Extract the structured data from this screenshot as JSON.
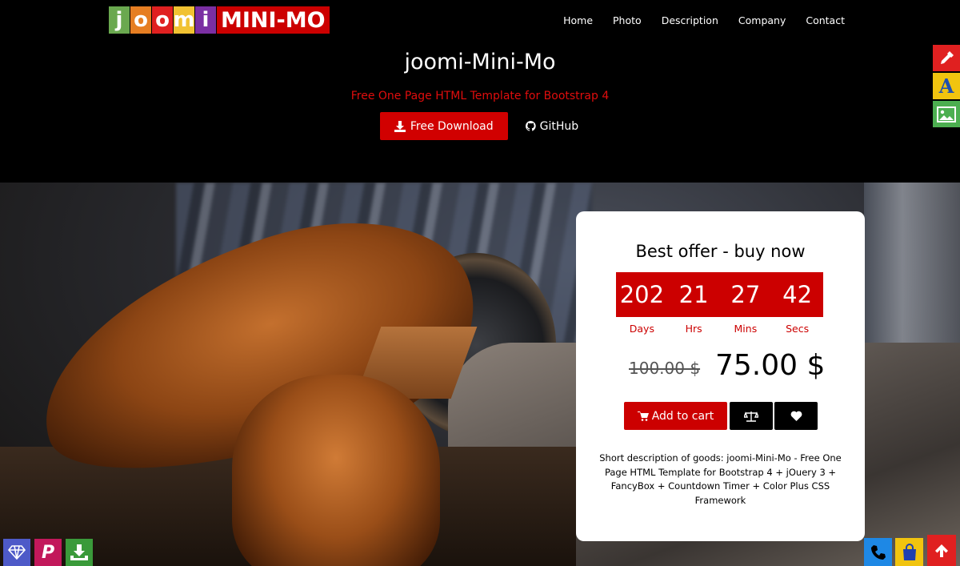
{
  "logo": {
    "letters": [
      {
        "char": "j",
        "color": "#6aa84f"
      },
      {
        "char": "o",
        "color": "#e67e22"
      },
      {
        "char": "o",
        "color": "#e02020"
      },
      {
        "char": "m",
        "color": "#f1c232"
      },
      {
        "char": "i",
        "color": "#7b2fa3"
      }
    ],
    "mini": "MINI-MO"
  },
  "nav": [
    "Home",
    "Photo",
    "Description",
    "Company",
    "Contact"
  ],
  "hero": {
    "title": "joomi-Mini-Mo",
    "subtitle": "Free One Page HTML Template for Bootstrap 4",
    "download_label": "Free Download",
    "github_label": "GitHub"
  },
  "offer": {
    "title": "Best offer - buy now",
    "timer": {
      "days": "202",
      "hrs": "21",
      "mins": "27",
      "secs": "42"
    },
    "timer_labels": {
      "days": "Days",
      "hrs": "Hrs",
      "mins": "Mins",
      "secs": "Secs"
    },
    "old_price": "100.00 $",
    "new_price": "75.00 $",
    "cart_label": "Add to cart",
    "description": "Short description of goods: joomi-Mini-Mo - Free One Page HTML Template for Bootstrap 4 + jOuery 3 + FancyBox + Countdown Timer + Color Plus CSS Framework"
  },
  "side_widgets": {
    "eyedropper_color": "#e02020",
    "font_color": "#f1c40f",
    "image_color": "#4caf50"
  },
  "bottom_left": {
    "diamond_color": "#4e5ac8",
    "paypal_color": "#c2185b",
    "download_color": "#3a9a3a"
  },
  "bottom_right": {
    "phone_color": "#1e88e5",
    "bag_color": "#f1c40f",
    "top_color": "#e02020"
  },
  "colors": {
    "accent": "#cc0000"
  }
}
